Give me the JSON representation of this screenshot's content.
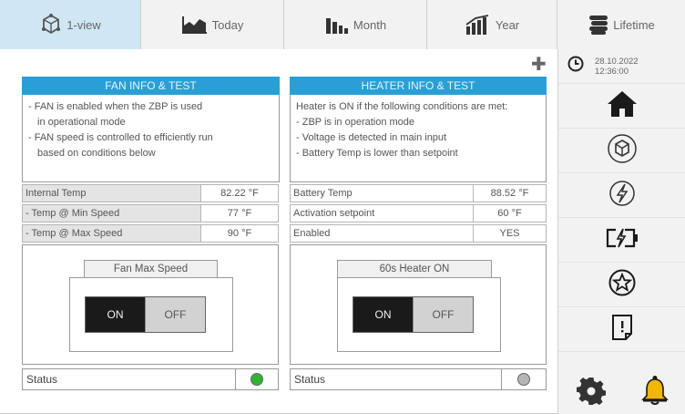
{
  "tabs": [
    {
      "label": "1-view",
      "icon": "cube-network-icon",
      "active": true
    },
    {
      "label": "Today",
      "icon": "area-chart-icon",
      "active": false
    },
    {
      "label": "Month",
      "icon": "bar-chart-icon",
      "active": false
    },
    {
      "label": "Year",
      "icon": "trend-chart-icon",
      "active": false
    },
    {
      "label": "Lifetime",
      "icon": "coin-stack-icon",
      "active": false
    }
  ],
  "sidebar": {
    "date": "28.10.2022",
    "time": "12:36:00",
    "items": [
      {
        "icon": "home-icon"
      },
      {
        "icon": "cube-network-icon"
      },
      {
        "icon": "lightning-icon"
      },
      {
        "icon": "battery-charge-icon"
      },
      {
        "icon": "star-icon"
      },
      {
        "icon": "document-alert-icon"
      }
    ],
    "bottom": [
      {
        "icon": "gear-icon"
      },
      {
        "icon": "bell-icon"
      }
    ],
    "colors": {
      "bell": "#f2b705",
      "gear": "#333333"
    }
  },
  "fan": {
    "title": "FAN INFO & TEST",
    "desc": [
      "- FAN is enabled when the ZBP is used",
      "in operational mode",
      "- FAN speed is controlled to efficiently run",
      "based on conditions below"
    ],
    "rows": [
      {
        "label": "Internal Temp",
        "value": "82.22 °F"
      },
      {
        "label": "- Temp @ Min Speed",
        "value": "77 °F"
      },
      {
        "label": "- Temp @ Max Speed",
        "value": "90 °F"
      }
    ],
    "control_title": "Fan Max Speed",
    "on_label": "ON",
    "off_label": "OFF",
    "status_label": "Status",
    "status_color": "#2fb52f"
  },
  "heater": {
    "title": "HEATER INFO & TEST",
    "desc": [
      "Heater is ON if the following conditions are met:",
      "- ZBP is in operation mode",
      "- Voltage is detected in main input",
      "- Battery Temp is lower than setpoint"
    ],
    "rows": [
      {
        "label": "Battery Temp",
        "value": "88.52 °F"
      },
      {
        "label": "Activation setpoint",
        "value": "60 °F"
      },
      {
        "label": "Enabled",
        "value": "YES"
      }
    ],
    "control_title": "60s Heater ON",
    "on_label": "ON",
    "off_label": "OFF",
    "status_label": "Status",
    "status_color": "#b5b5b5"
  },
  "accent_color": "#2a9fd6"
}
